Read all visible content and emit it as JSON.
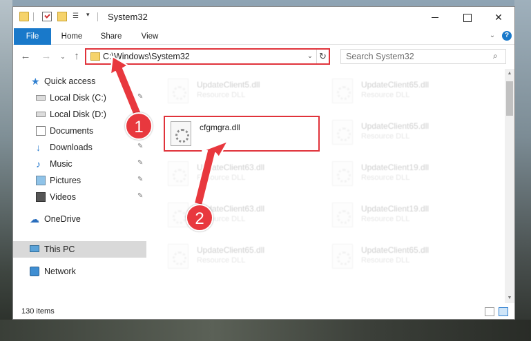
{
  "window": {
    "title": "System32",
    "minimize_label": "",
    "maximize_label": "",
    "close_label": "✕"
  },
  "ribbon": {
    "tabs": [
      "File",
      "Home",
      "Share",
      "View"
    ],
    "expand_glyph": "⌄",
    "help_glyph": "?"
  },
  "address": {
    "path": "C:\\Windows\\System32",
    "refresh_glyph": "↻",
    "dropdown_glyph": "⌄"
  },
  "search": {
    "placeholder": "Search System32",
    "icon_glyph": "⌕"
  },
  "nav_buttons": {
    "back": "←",
    "forward": "→",
    "recent": "⌄",
    "up": "↑"
  },
  "sidebar": {
    "items": [
      {
        "label": "Quick access",
        "icon": "star-icon",
        "pinned": false
      },
      {
        "label": "Local Disk (C:)",
        "icon": "drive-icon",
        "pinned": true
      },
      {
        "label": "Local Disk (D:)",
        "icon": "drive-icon",
        "pinned": false
      },
      {
        "label": "Documents",
        "icon": "documents-icon",
        "pinned": true
      },
      {
        "label": "Downloads",
        "icon": "download-icon",
        "pinned": true
      },
      {
        "label": "Music",
        "icon": "music-icon",
        "pinned": true
      },
      {
        "label": "Pictures",
        "icon": "pictures-icon",
        "pinned": true
      },
      {
        "label": "Videos",
        "icon": "videos-icon",
        "pinned": true
      },
      {
        "label": "OneDrive",
        "icon": "cloud-icon",
        "pinned": false
      },
      {
        "label": "This PC",
        "icon": "computer-icon",
        "pinned": false,
        "selected": true
      },
      {
        "label": "Network",
        "icon": "network-icon",
        "pinned": false
      }
    ],
    "pin_glyph": "📌"
  },
  "files": [
    {
      "name": "UpdateClient5.dll",
      "type": "Resource DLL",
      "faded": true
    },
    {
      "name": "UpdateClient65.dll",
      "type": "Resource DLL",
      "faded": true
    },
    {
      "name": "cfgmgra.dll",
      "type": "",
      "faded": false,
      "highlighted": true
    },
    {
      "name": "UpdateClient65.dll",
      "type": "Resource DLL",
      "faded": true
    },
    {
      "name": "UpdateClient63.dll",
      "type": "Resource DLL",
      "faded": true
    },
    {
      "name": "UpdateClient19.dll",
      "type": "Resource DLL",
      "faded": true
    },
    {
      "name": "UpdateClient63.dll",
      "type": "Resource DLL",
      "faded": true
    },
    {
      "name": "UpdateClient19.dll",
      "type": "Resource DLL",
      "faded": true
    },
    {
      "name": "UpdateClient65.dll",
      "type": "Resource DLL",
      "faded": true
    },
    {
      "name": "UpdateClient65.dll",
      "type": "Resource DLL",
      "faded": true
    }
  ],
  "status": {
    "item_count": "130 items"
  },
  "annotations": {
    "step1": "1",
    "step2": "2",
    "color": "#e8383e"
  }
}
